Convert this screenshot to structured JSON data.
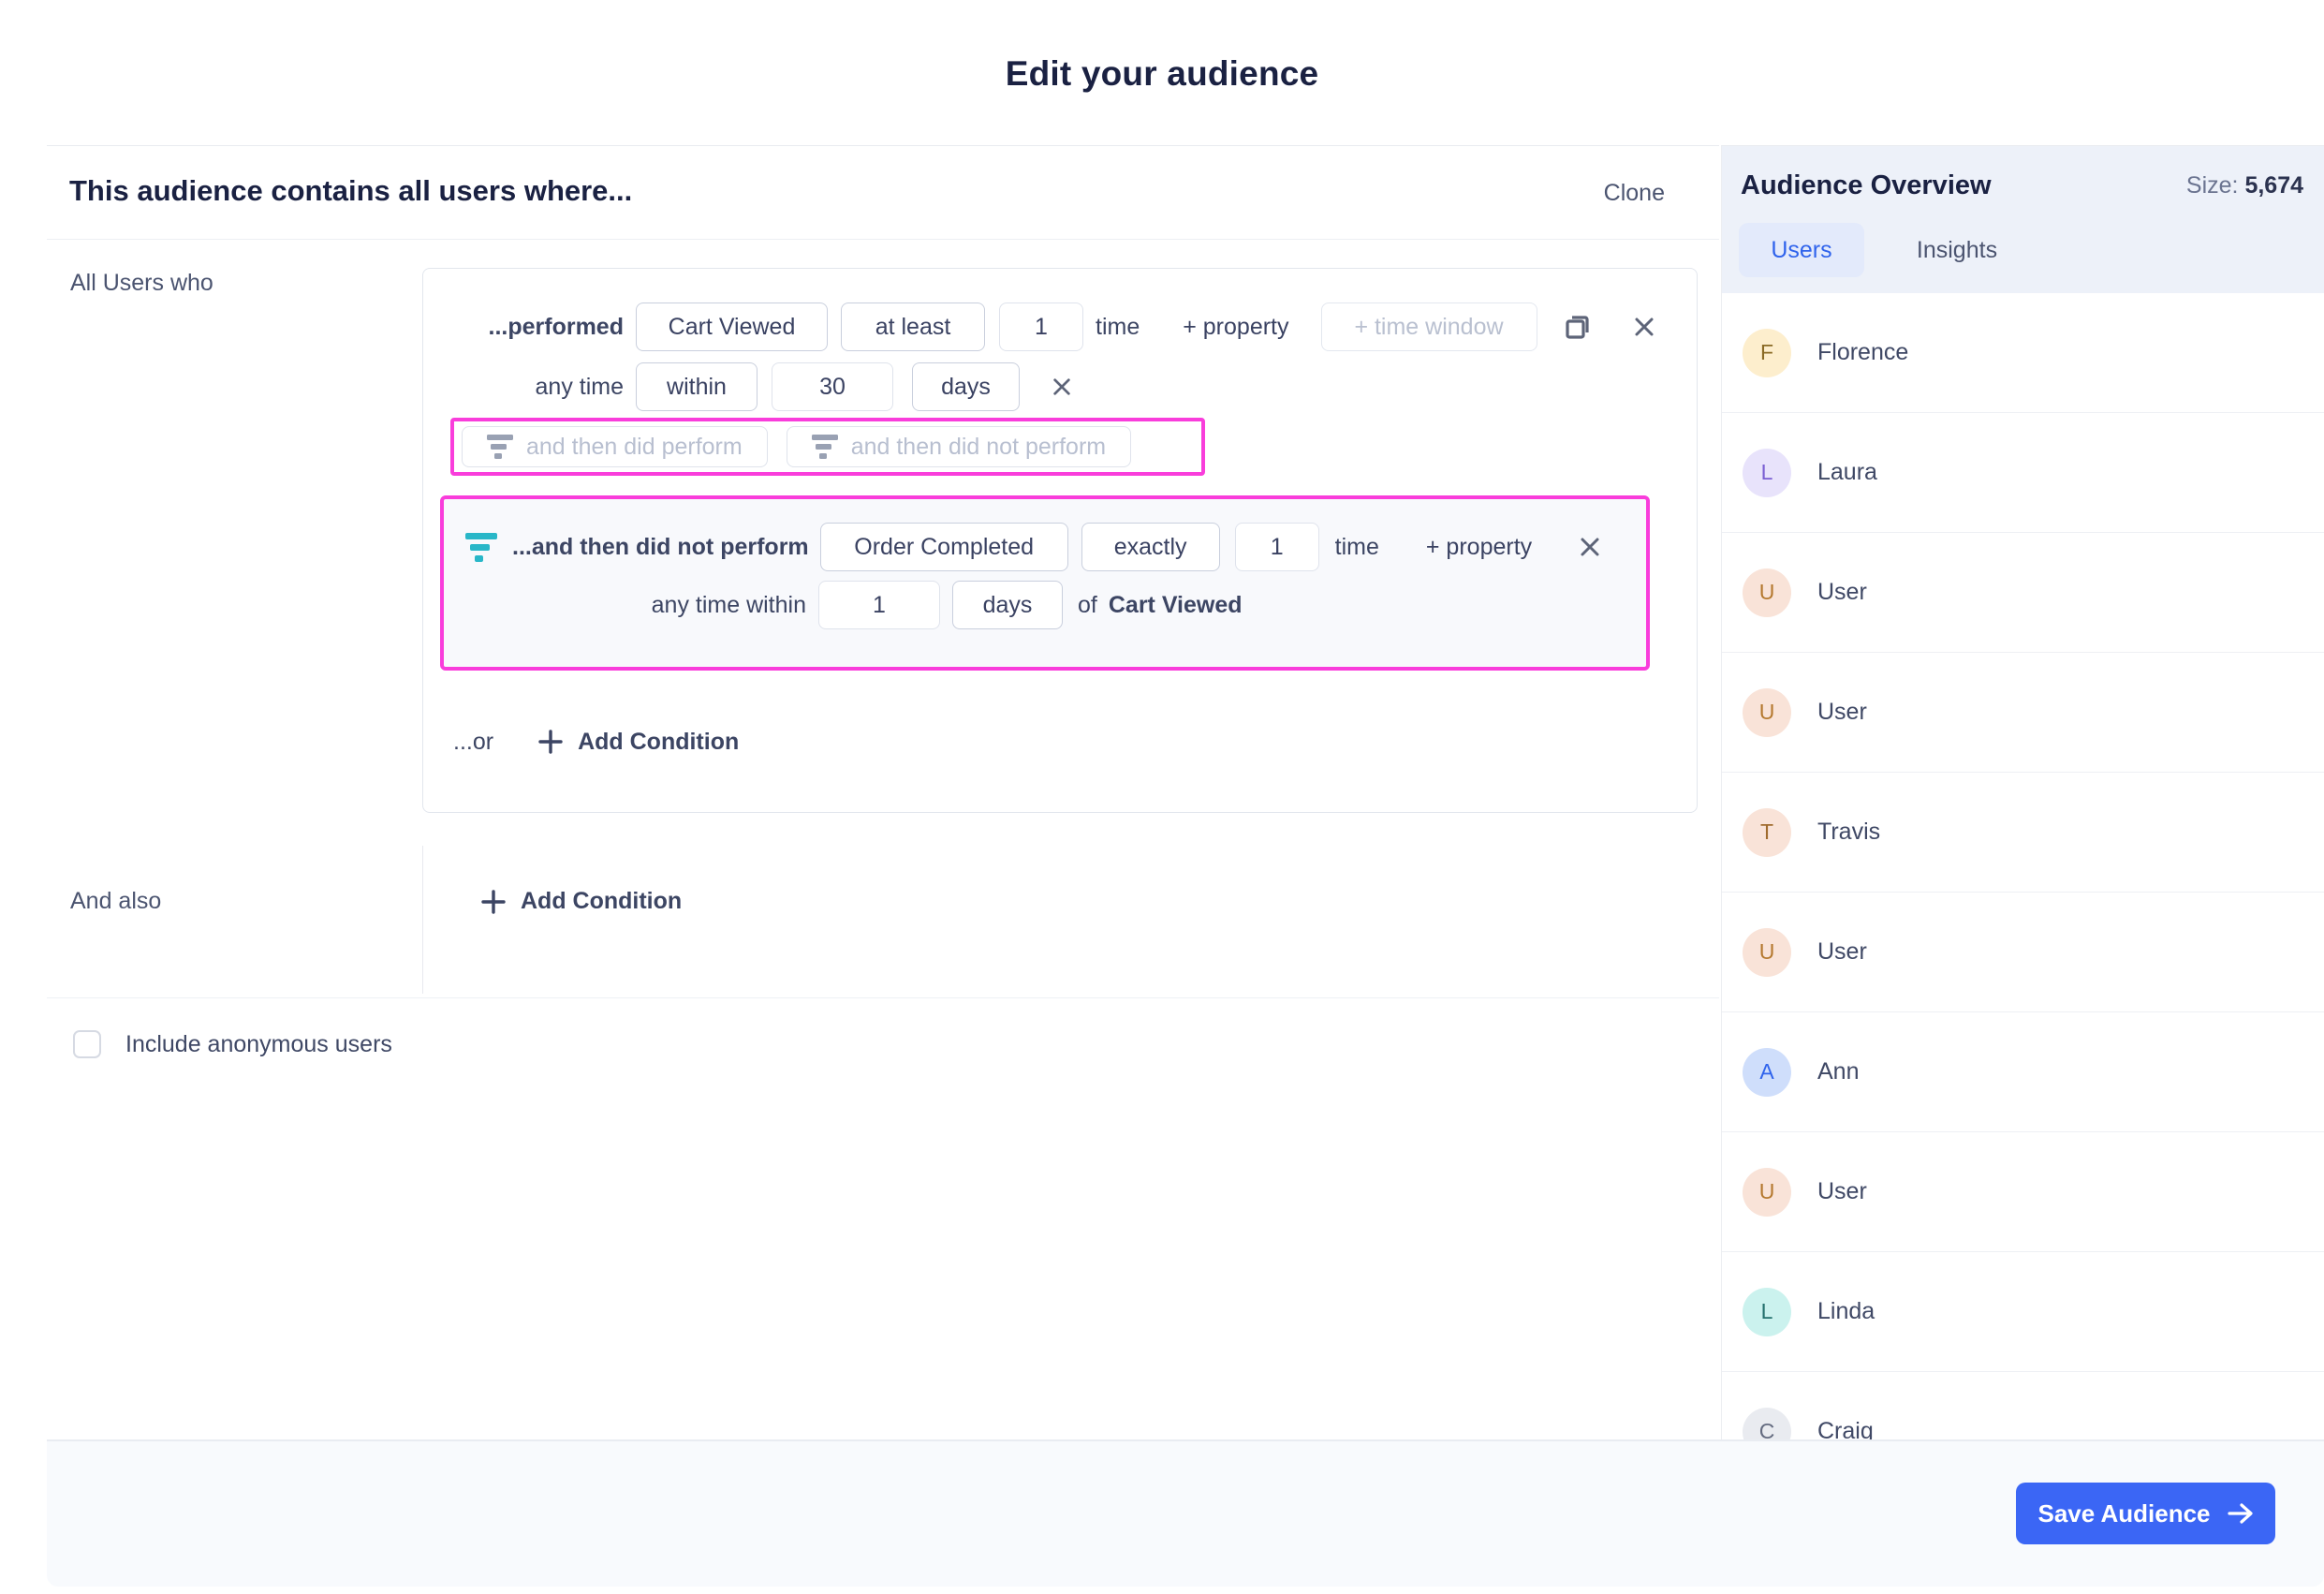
{
  "page": {
    "title": "Edit your audience"
  },
  "builder": {
    "heading": "This audience contains all users where...",
    "clone_label": "Clone",
    "group_label": "All Users who",
    "condition1": {
      "prefix": "...performed",
      "event": "Cart Viewed",
      "operator": "at least",
      "count": "1",
      "time_label": "time",
      "add_property_label": "+ property",
      "time_window_placeholder": "+ time window",
      "row2_prefix": "any time",
      "row2_operator": "within",
      "row2_value": "30",
      "row2_unit": "days"
    },
    "sequence_buttons": {
      "perform_label": "and then did perform",
      "not_perform_label": "and then did not perform"
    },
    "condition2": {
      "prefix": "...and then did not perform",
      "event": "Order Completed",
      "operator": "exactly",
      "count": "1",
      "time_label": "time",
      "add_property_label": "+ property",
      "row2_prefix": "any time within",
      "row2_value": "1",
      "row2_unit": "days",
      "of_label": "of",
      "of_event": "Cart Viewed"
    },
    "or_label": "...or",
    "add_condition_label": "Add Condition",
    "and_also_label": "And also",
    "add_condition2_label": "Add Condition",
    "anonymous_checkbox_label": "Include anonymous users"
  },
  "overview": {
    "title": "Audience Overview",
    "size_label": "Size:",
    "size_value": "5,674",
    "tabs": [
      {
        "label": "Users",
        "active": true
      },
      {
        "label": "Insights",
        "active": false
      }
    ],
    "users": [
      {
        "initial": "F",
        "name": "Florence",
        "bg": "#fdeecd",
        "fg": "#8a6a25"
      },
      {
        "initial": "L",
        "name": "Laura",
        "bg": "#e8e3fb",
        "fg": "#7a5fd3"
      },
      {
        "initial": "U",
        "name": "User",
        "bg": "#f9e3d8",
        "fg": "#b5792f"
      },
      {
        "initial": "U",
        "name": "User",
        "bg": "#f9e3d8",
        "fg": "#b5792f"
      },
      {
        "initial": "T",
        "name": "Travis",
        "bg": "#f9e3d8",
        "fg": "#a06b2d"
      },
      {
        "initial": "U",
        "name": "User",
        "bg": "#f9e3d8",
        "fg": "#b5792f"
      },
      {
        "initial": "A",
        "name": "Ann",
        "bg": "#cfdefb",
        "fg": "#2f63ec"
      },
      {
        "initial": "U",
        "name": "User",
        "bg": "#f9e3d8",
        "fg": "#b5792f"
      },
      {
        "initial": "L",
        "name": "Linda",
        "bg": "#cbf2ee",
        "fg": "#23706d"
      },
      {
        "initial": "C",
        "name": "Craig",
        "bg": "#e9ebf0",
        "fg": "#646b80"
      }
    ]
  },
  "footer": {
    "save_label": "Save Audience"
  },
  "colors": {
    "accent_blue": "#3b66f5",
    "tab_blue": "#2f63ec",
    "annotation_magenta": "#f93ddb",
    "funnel_teal": "#29b7c8",
    "panel_header_bg": "#edf1f9",
    "subcondition_bg": "#f8f9fc"
  }
}
